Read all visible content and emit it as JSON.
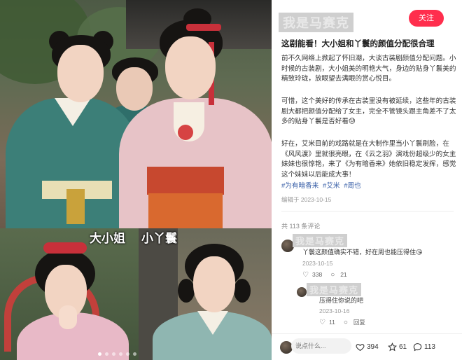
{
  "media": {
    "captions": [
      "大小姐",
      "小丫鬟"
    ],
    "slides_total": 6,
    "active_slide": 1
  },
  "post": {
    "author": "我是马赛克",
    "follow_label": "关注",
    "title": "这剧能看！大小姐和丫鬟的颜值分配很合理",
    "paragraphs": [
      "前不久网络上掀起了怀旧潮，大谈古装剧颜值分配问题。小时候的古装剧，大小姐美的明艳大气，身边的贴身丫鬟美的精致玲珑，放眼望去满眼的赏心悦目。",
      "可惜，这个美好的传承在古装里没有被延续，这些年的古装剧大都把颜值分配给了女主，完全不管镜头跟主角差不了太多的贴身丫鬟是否好看😓",
      "好在，艾米目前的戏路就是在大制作里当小丫鬟刷脸，在《风风渡》里就很亮眼，在《云之羽》演戏份超级少的女主妹妹也很惊艳，来了《为有暗香来》她依旧稳定发挥，感觉这个妹妹以后能成大事！"
    ],
    "hashtags": [
      "#为有暗香来",
      "#艾米",
      "#周也"
    ],
    "edited": "编辑于 2023-10-15",
    "comment_count_label": "共 113 条评论"
  },
  "comments": [
    {
      "author": "我是马赛克",
      "text": "丫鬟这颜值确实不错，好在周也能压得住😘",
      "date": "2023-10-15",
      "likes": "338",
      "replies": "21"
    },
    {
      "author": "我是马赛克",
      "text": "压得住你说的吧",
      "date": "2023-10-16",
      "likes": "11",
      "replies": "回复"
    }
  ],
  "bottom": {
    "comment_placeholder": "说点什么...",
    "likes": "394",
    "favorites": "61",
    "comments": "113"
  },
  "colors": {
    "follow_button": "#ff2e4d",
    "hashtag": "#3a60a8"
  },
  "icons": [
    "heart-icon",
    "star-icon",
    "comment-icon",
    "reply-icon"
  ]
}
